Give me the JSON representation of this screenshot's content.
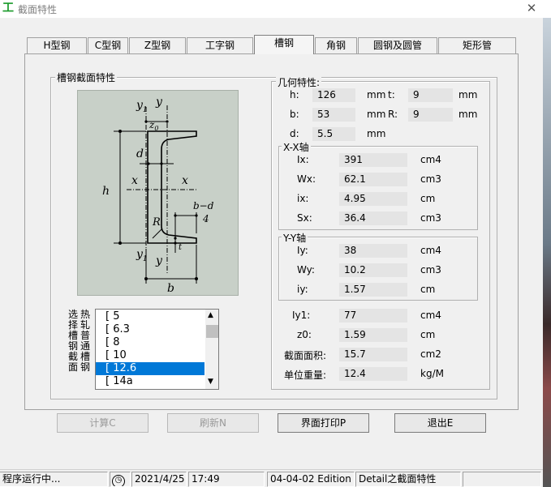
{
  "window": {
    "title": "截面特性",
    "icon_glyph": "工"
  },
  "tabs": [
    "H型钢",
    "C型钢",
    "Z型钢",
    "工字钢",
    "槽钢",
    "角钢",
    "圆钢及圆管",
    "矩形管"
  ],
  "active_tab": "槽钢",
  "section_group": {
    "title": "槽钢截面特性",
    "drawing_labels": {
      "y1_top": "y",
      "y1_sub": "1",
      "y_top": "y",
      "z0": "z",
      "z0_sub": "0",
      "d": "d",
      "x_left": "x",
      "x_right": "x",
      "h": "h",
      "b_d": "b−d",
      "b_d_den": "4",
      "R": "R",
      "t": "t",
      "y1_bot": "y",
      "y1_bot_sub": "1",
      "y_bot": "y",
      "b": "b"
    },
    "select_label_col1": "选择槽钢截面",
    "select_label_col2": "热轧普通槽钢",
    "list_items": [
      "[ 5",
      "[ 6.3",
      "[ 8",
      "[ 10",
      "[ 12.6",
      "[ 14a"
    ],
    "selected_item": "[ 12.6"
  },
  "geometry": {
    "title": "几何特性:",
    "h": {
      "label": "h:",
      "value": "126",
      "unit": "mm"
    },
    "t": {
      "label": "t:",
      "value": "9",
      "unit": "mm"
    },
    "b": {
      "label": "b:",
      "value": "53",
      "unit": "mm"
    },
    "R": {
      "label": "R:",
      "value": "9",
      "unit": "mm"
    },
    "d": {
      "label": "d:",
      "value": "5.5",
      "unit": "mm"
    }
  },
  "xx_axis": {
    "title": "X-X轴",
    "rows": [
      {
        "label": "Ix:",
        "value": "391",
        "unit": "cm4"
      },
      {
        "label": "Wx:",
        "value": "62.1",
        "unit": "cm3"
      },
      {
        "label": "ix:",
        "value": "4.95",
        "unit": "cm"
      },
      {
        "label": "Sx:",
        "value": "36.4",
        "unit": "cm3"
      }
    ]
  },
  "yy_axis": {
    "title": "Y-Y轴",
    "rows": [
      {
        "label": "Iy:",
        "value": "38",
        "unit": "cm4"
      },
      {
        "label": "Wy:",
        "value": "10.2",
        "unit": "cm3"
      },
      {
        "label": "iy:",
        "value": "1.57",
        "unit": "cm"
      }
    ]
  },
  "other": {
    "rows": [
      {
        "label": "Iy1:",
        "value": "77",
        "unit": "cm4"
      },
      {
        "label": "z0:",
        "value": "1.59",
        "unit": "cm"
      },
      {
        "label": "截面面积:",
        "value": "15.7",
        "unit": "cm2"
      },
      {
        "label": "单位重量:",
        "value": "12.4",
        "unit": "kg/M"
      }
    ]
  },
  "buttons": {
    "calc": "计算C",
    "refresh": "刷新N",
    "print": "界面打印P",
    "exit": "退出E"
  },
  "status": {
    "state": "程序运行中...",
    "date": "2021/4/25",
    "time": "17:49",
    "edition": "04-04-02 Edition",
    "detail": "Detail之截面特性"
  },
  "colors": {
    "drawing_bg": "#c8d0c8",
    "selection": "#0078d7",
    "icon": "#1a9a2a"
  }
}
